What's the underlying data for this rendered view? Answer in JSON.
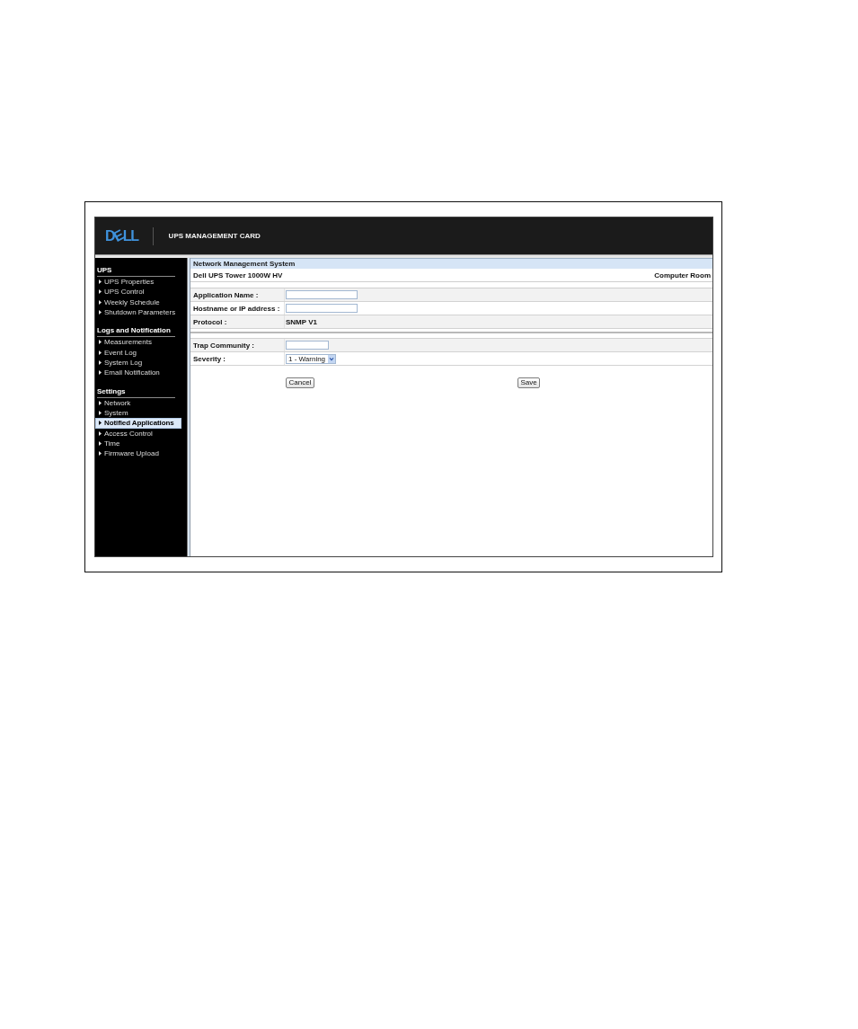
{
  "header": {
    "logo": "DELL",
    "title": "UPS MANAGEMENT CARD"
  },
  "sidebar": {
    "sections": [
      {
        "title": "UPS",
        "items": [
          {
            "label": "UPS Properties",
            "selected": false
          },
          {
            "label": "UPS Control",
            "selected": false
          },
          {
            "label": "Weekly Schedule",
            "selected": false
          },
          {
            "label": "Shutdown Parameters",
            "selected": false
          }
        ]
      },
      {
        "title": "Logs and Notification",
        "items": [
          {
            "label": "Measurements",
            "selected": false
          },
          {
            "label": "Event Log",
            "selected": false
          },
          {
            "label": "System Log",
            "selected": false
          },
          {
            "label": "Email Notification",
            "selected": false
          }
        ]
      },
      {
        "title": "Settings",
        "items": [
          {
            "label": "Network",
            "selected": false
          },
          {
            "label": "System",
            "selected": false
          },
          {
            "label": "Notified Applications",
            "selected": true
          },
          {
            "label": "Access Control",
            "selected": false
          },
          {
            "label": "Time",
            "selected": false
          },
          {
            "label": "Firmware Upload",
            "selected": false
          }
        ]
      }
    ]
  },
  "main": {
    "title": "Network Management System",
    "device": "Dell UPS Tower 1000W HV",
    "location": "Computer Room",
    "field_groups": [
      {
        "rows": [
          {
            "label": "Application Name :",
            "kind": "input"
          },
          {
            "label": "Hostname or IP address :",
            "kind": "input"
          },
          {
            "label": "Protocol :",
            "kind": "static",
            "value": "SNMP V1"
          }
        ]
      },
      {
        "rows": [
          {
            "label": "Trap Community :",
            "kind": "input"
          },
          {
            "label": "Severity :",
            "kind": "select",
            "value": "1 - Warning"
          }
        ]
      }
    ],
    "buttons": [
      {
        "label": "Cancel"
      },
      {
        "label": "Save"
      }
    ]
  }
}
